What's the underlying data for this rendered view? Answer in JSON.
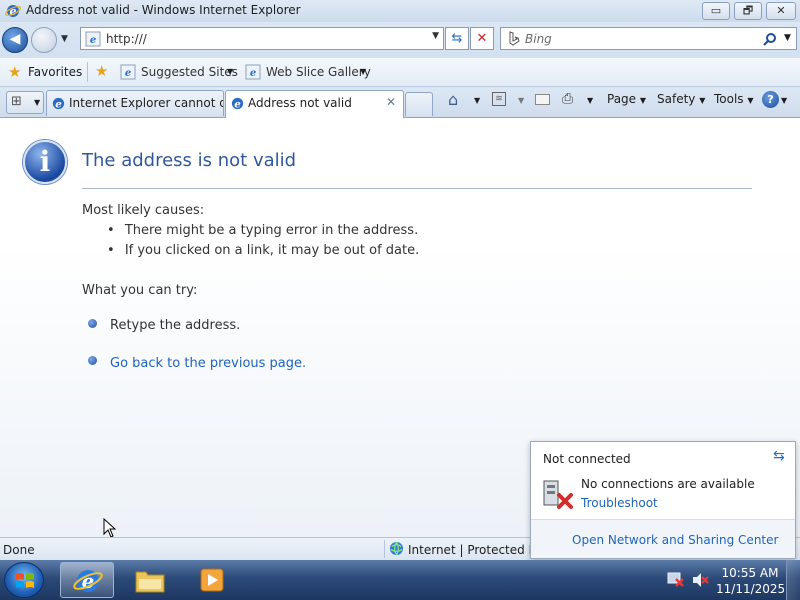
{
  "window": {
    "title": "Address not valid - Windows Internet Explorer",
    "buttons": {
      "minimize": "▭",
      "maximize": "🗗",
      "close": "✕"
    }
  },
  "nav": {
    "address_value": "http:///",
    "search_placeholder": "Bing"
  },
  "favorites_bar": {
    "favorites_label": "Favorites",
    "suggested_sites": "Suggested Sites",
    "web_slice_gallery": "Web Slice Gallery"
  },
  "tabs": [
    {
      "label": "Internet Explorer cannot di...",
      "active": false
    },
    {
      "label": "Address not valid",
      "active": true
    }
  ],
  "command_bar": {
    "page": "Page",
    "safety": "Safety",
    "tools": "Tools"
  },
  "content": {
    "title": "The address is not valid",
    "causes_heading": "Most likely causes:",
    "causes": [
      "There might be a typing error in the address.",
      "If you clicked on a link, it may be out of date."
    ],
    "try_heading": "What you can try:",
    "try_items": [
      {
        "text": "Retype the address.",
        "link": false
      },
      {
        "text": "Go back to the previous page.",
        "link": true
      }
    ]
  },
  "status_bar": {
    "status": "Done",
    "zone": "Internet | Protected Mo"
  },
  "network_popup": {
    "title": "Not connected",
    "message": "No connections are available",
    "troubleshoot": "Troubleshoot",
    "open_center": "Open Network and Sharing Center"
  },
  "taskbar": {
    "time": "10:55 AM",
    "date": "11/11/2025"
  },
  "colors": {
    "accent_blue": "#30589c",
    "link_blue": "#1f64b8",
    "error_red": "#d62b2b"
  }
}
